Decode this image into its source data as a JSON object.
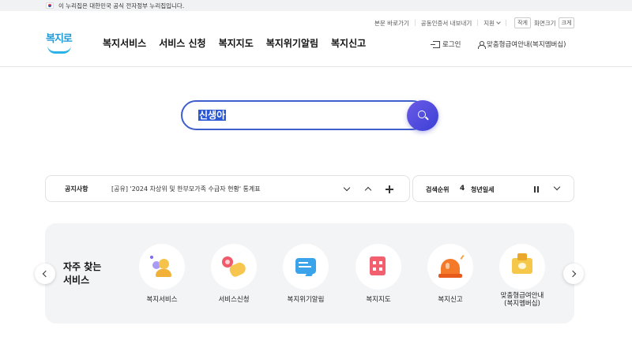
{
  "gov_banner": {
    "text": "이 누리집은 대한민국 공식 전자정부 누리집입니다."
  },
  "utility": {
    "skip_link": "본문 바로가기",
    "cert": "공동인증서 내보내기",
    "support": "지원",
    "font_small": "작게",
    "font_label": "화면크기",
    "font_large": "크게"
  },
  "header": {
    "logo_text": "복지로",
    "nav": [
      "복지서비스",
      "서비스 신청",
      "복지지도",
      "복지위기알림",
      "복지신고"
    ],
    "login": "로그인",
    "membership": "맞춤형급여안내(복지멤버십)"
  },
  "search": {
    "value": "신생아"
  },
  "notice": {
    "label": "공지사항",
    "text": "[공유] '2024 차상위 및 한부모가족 수급자 현황' 통계표"
  },
  "ranking": {
    "label": "검색순위",
    "rank": "4",
    "keyword": "청년일세"
  },
  "services": {
    "title_line1": "자주 찾는",
    "title_line2": "서비스",
    "items": [
      {
        "label": "복지서비스",
        "icon": "people-icon"
      },
      {
        "label": "서비스신청",
        "icon": "hand-touch-icon"
      },
      {
        "label": "복지위기알림",
        "icon": "chat-bubble-icon"
      },
      {
        "label": "복지지도",
        "icon": "building-icon"
      },
      {
        "label": "복지신고",
        "icon": "siren-icon"
      },
      {
        "label": "맞춤형급여안내",
        "label2": "(복지멤버십)",
        "icon": "membership-card-icon"
      }
    ]
  },
  "colors": {
    "accent": "#3f5fcf",
    "search_button": "#5a4fe0",
    "logo": "#1f9ad7",
    "panel_bg": "#f3f4f6"
  }
}
